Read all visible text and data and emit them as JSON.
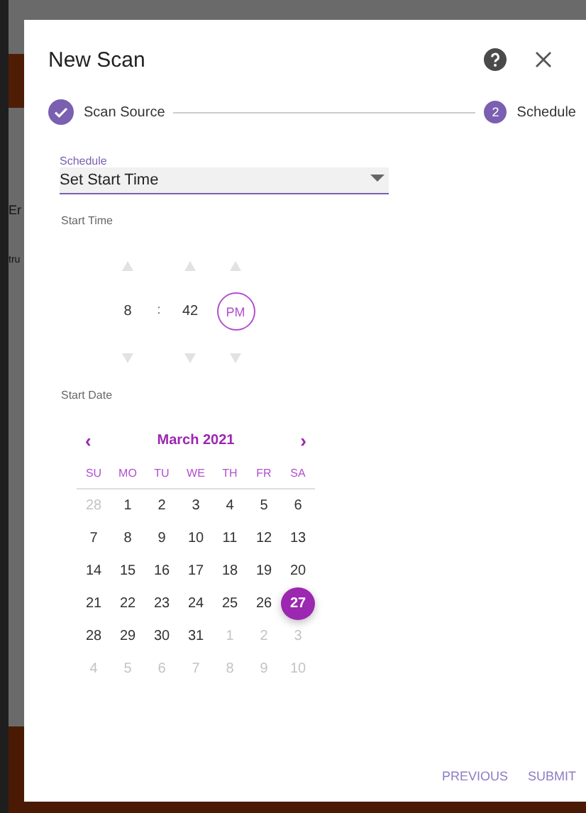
{
  "backdrop": {
    "texts": [
      "Er",
      "tru"
    ]
  },
  "dialog": {
    "title": "New Scan"
  },
  "steps": [
    {
      "label": "Scan Source",
      "completed": true
    },
    {
      "label": "Schedule",
      "number": "2",
      "completed": false
    }
  ],
  "schedule": {
    "label": "Schedule",
    "value": "Set Start Time"
  },
  "start_time": {
    "label": "Start Time",
    "hour": "8",
    "separator": ":",
    "minute": "42",
    "period": "PM"
  },
  "start_date": {
    "label": "Start Date",
    "month": "March 2021",
    "prev": "‹",
    "next": "›",
    "weekdays": [
      "SU",
      "MO",
      "TU",
      "WE",
      "TH",
      "FR",
      "SA"
    ],
    "weeks": [
      [
        {
          "day": "28",
          "outside": true,
          "selected": false
        },
        {
          "day": "1",
          "outside": false,
          "selected": false
        },
        {
          "day": "2",
          "outside": false,
          "selected": false
        },
        {
          "day": "3",
          "outside": false,
          "selected": false
        },
        {
          "day": "4",
          "outside": false,
          "selected": false
        },
        {
          "day": "5",
          "outside": false,
          "selected": false
        },
        {
          "day": "6",
          "outside": false,
          "selected": false
        }
      ],
      [
        {
          "day": "7",
          "outside": false,
          "selected": false
        },
        {
          "day": "8",
          "outside": false,
          "selected": false
        },
        {
          "day": "9",
          "outside": false,
          "selected": false
        },
        {
          "day": "10",
          "outside": false,
          "selected": false
        },
        {
          "day": "11",
          "outside": false,
          "selected": false
        },
        {
          "day": "12",
          "outside": false,
          "selected": false
        },
        {
          "day": "13",
          "outside": false,
          "selected": false
        }
      ],
      [
        {
          "day": "14",
          "outside": false,
          "selected": false
        },
        {
          "day": "15",
          "outside": false,
          "selected": false
        },
        {
          "day": "16",
          "outside": false,
          "selected": false
        },
        {
          "day": "17",
          "outside": false,
          "selected": false
        },
        {
          "day": "18",
          "outside": false,
          "selected": false
        },
        {
          "day": "19",
          "outside": false,
          "selected": false
        },
        {
          "day": "20",
          "outside": false,
          "selected": false
        }
      ],
      [
        {
          "day": "21",
          "outside": false,
          "selected": false
        },
        {
          "day": "22",
          "outside": false,
          "selected": false
        },
        {
          "day": "23",
          "outside": false,
          "selected": false
        },
        {
          "day": "24",
          "outside": false,
          "selected": false
        },
        {
          "day": "25",
          "outside": false,
          "selected": false
        },
        {
          "day": "26",
          "outside": false,
          "selected": false
        },
        {
          "day": "27",
          "outside": false,
          "selected": true
        }
      ],
      [
        {
          "day": "28",
          "outside": false,
          "selected": false
        },
        {
          "day": "29",
          "outside": false,
          "selected": false
        },
        {
          "day": "30",
          "outside": false,
          "selected": false
        },
        {
          "day": "31",
          "outside": false,
          "selected": false
        },
        {
          "day": "1",
          "outside": true,
          "selected": false
        },
        {
          "day": "2",
          "outside": true,
          "selected": false
        },
        {
          "day": "3",
          "outside": true,
          "selected": false
        }
      ],
      [
        {
          "day": "4",
          "outside": true,
          "selected": false
        },
        {
          "day": "5",
          "outside": true,
          "selected": false
        },
        {
          "day": "6",
          "outside": true,
          "selected": false
        },
        {
          "day": "7",
          "outside": true,
          "selected": false
        },
        {
          "day": "8",
          "outside": true,
          "selected": false
        },
        {
          "day": "9",
          "outside": true,
          "selected": false
        },
        {
          "day": "10",
          "outside": true,
          "selected": false
        }
      ]
    ]
  },
  "buttons": [
    "PREVIOUS",
    "SUBMIT"
  ]
}
